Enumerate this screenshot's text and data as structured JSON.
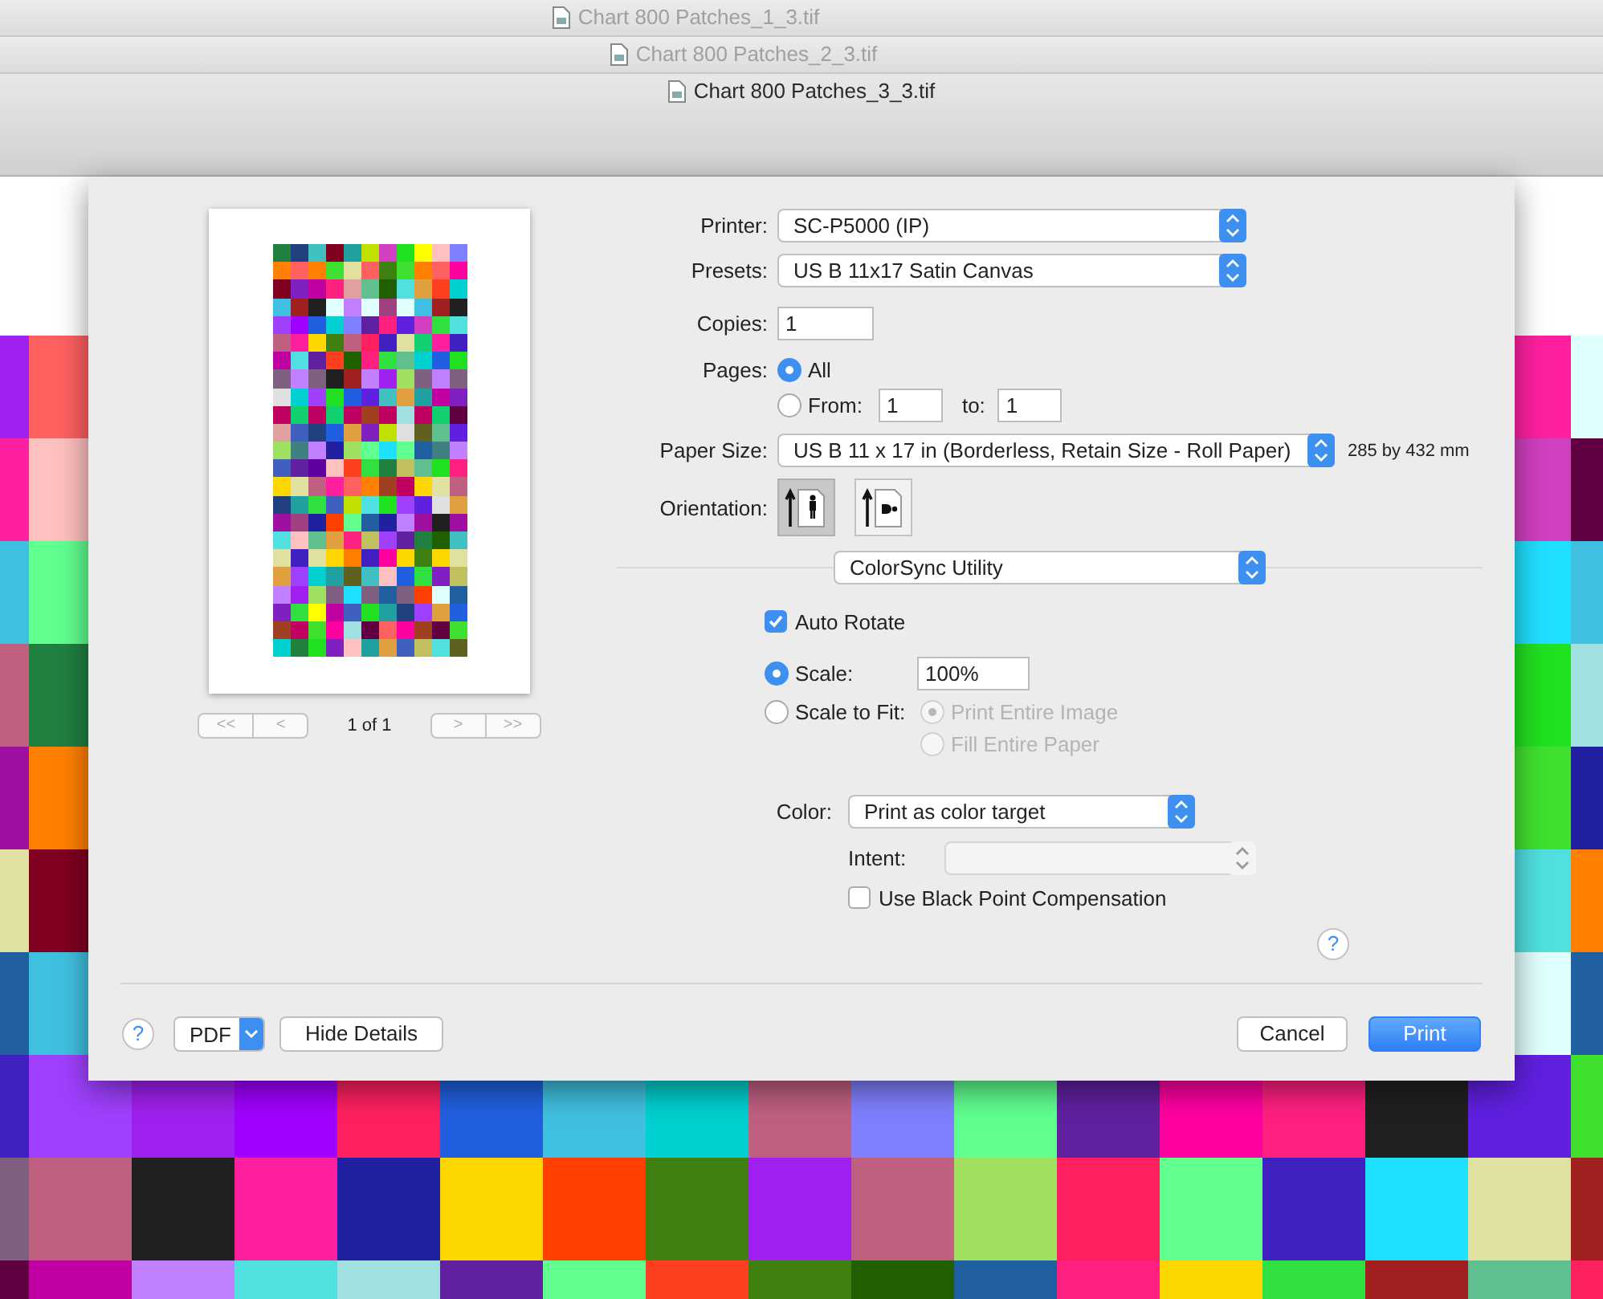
{
  "windows": [
    {
      "title": "Chart 800 Patches_1_3.tif",
      "selected": false
    },
    {
      "title": "Chart 800 Patches_2_3.tif",
      "selected": false
    },
    {
      "title": "Chart 800 Patches_3_3.tif",
      "selected": true
    }
  ],
  "preview": {
    "nav_left": [
      "<<",
      "<"
    ],
    "page_indicator": "1 of 1",
    "nav_right": [
      ">",
      ">>"
    ]
  },
  "printer": {
    "label": "Printer:",
    "value": "SC-P5000 (IP)"
  },
  "presets": {
    "label": "Presets:",
    "value": "US B 11x17 Satin Canvas"
  },
  "copies": {
    "label": "Copies:",
    "value": "1"
  },
  "pages": {
    "label": "Pages:",
    "options": [
      {
        "label": "All",
        "selected": true
      },
      {
        "label": "From:",
        "selected": false
      }
    ],
    "from": "1",
    "to_label": "to:",
    "to": "1"
  },
  "paper_size": {
    "label": "Paper Size:",
    "value": "US B 11 x 17 in (Borderless, Retain Size - Roll Paper)",
    "dimensions": "285 by 432 mm"
  },
  "orientation": {
    "label": "Orientation:",
    "options": [
      {
        "kind": "portrait",
        "selected": true
      },
      {
        "kind": "landscape",
        "selected": false
      }
    ]
  },
  "panel_menu": {
    "value": "ColorSync Utility"
  },
  "auto_rotate": {
    "label": "Auto Rotate",
    "checked": true
  },
  "scale_options": [
    {
      "label": "Scale:",
      "selected": true
    },
    {
      "label": "Scale to Fit:",
      "selected": false
    }
  ],
  "scale_value": "100%",
  "fit_options": [
    {
      "label": "Print Entire Image",
      "selected": true,
      "disabled": true
    },
    {
      "label": "Fill Entire Paper",
      "selected": false,
      "disabled": true
    }
  ],
  "color": {
    "label": "Color:",
    "value": "Print as color target"
  },
  "intent": {
    "label": "Intent:",
    "disabled": true
  },
  "black_point": {
    "label": "Use Black Point Compensation",
    "checked": false
  },
  "panel_help": "?",
  "footer": {
    "help": "?",
    "pdf": "PDF",
    "hide_details": "Hide Details",
    "cancel": "Cancel",
    "print": "Print"
  }
}
